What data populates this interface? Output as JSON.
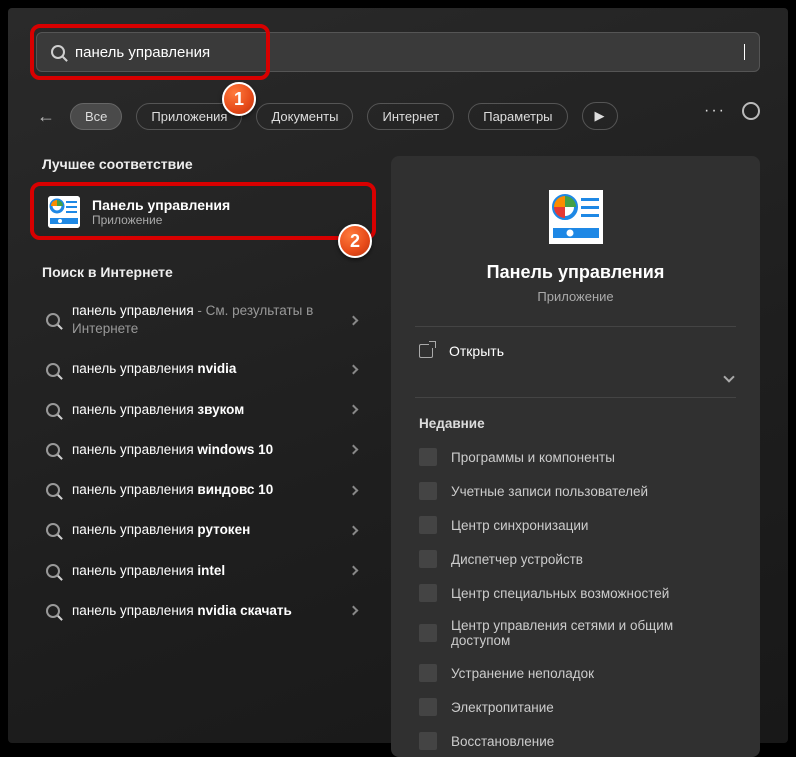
{
  "search": {
    "value": "панель управления"
  },
  "filters": {
    "back": "←",
    "items": [
      "Все",
      "Приложения",
      "Документы",
      "Интернет",
      "Параметры"
    ],
    "active_index": 0,
    "play_glyph": "▶"
  },
  "left": {
    "best_match_heading": "Лучшее соответствие",
    "best_match": {
      "title": "Панель управления",
      "subtitle": "Приложение"
    },
    "web_heading": "Поиск в Интернете",
    "web_items": [
      {
        "prefix": "панель управления",
        "bold": "",
        "suffix": " - См. результаты в Интернете"
      },
      {
        "prefix": "панель управления ",
        "bold": "nvidia",
        "suffix": ""
      },
      {
        "prefix": "панель управления ",
        "bold": "звуком",
        "suffix": ""
      },
      {
        "prefix": "панель управления ",
        "bold": "windows 10",
        "suffix": ""
      },
      {
        "prefix": "панель управления ",
        "bold": "виндовс 10",
        "suffix": ""
      },
      {
        "prefix": "панель управления ",
        "bold": "рутокен",
        "suffix": ""
      },
      {
        "prefix": "панель управления ",
        "bold": "intel",
        "suffix": ""
      },
      {
        "prefix": "панель управления ",
        "bold": "nvidia скачать",
        "suffix": ""
      }
    ]
  },
  "right": {
    "title": "Панель управления",
    "subtitle": "Приложение",
    "open_label": "Открыть",
    "recent_heading": "Недавние",
    "recent_items": [
      "Программы и компоненты",
      "Учетные записи пользователей",
      "Центр синхронизации",
      "Диспетчер устройств",
      "Центр специальных возможностей",
      "Центр управления сетями и общим доступом",
      "Устранение неполадок",
      "Электропитание",
      "Восстановление"
    ]
  },
  "annotations": {
    "b1": "1",
    "b2": "2"
  }
}
